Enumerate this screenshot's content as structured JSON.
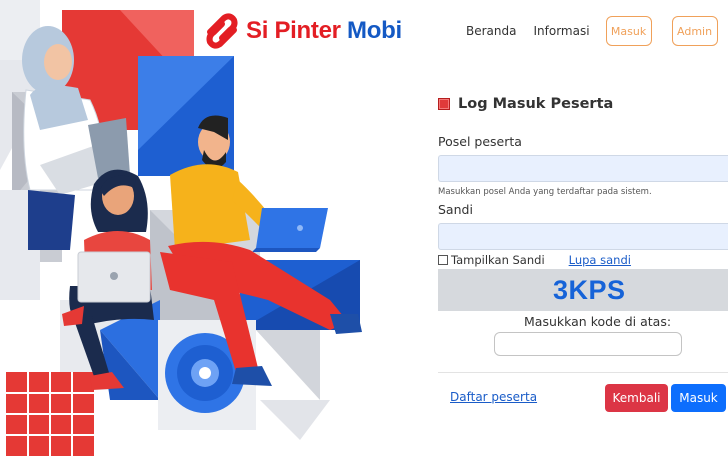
{
  "brand": {
    "name_part1": "Si Pinter ",
    "name_part2": "Mobi",
    "logo_icon": "si-pinter-logo-icon",
    "color_red": "#e31e24",
    "color_blue": "#1459c4"
  },
  "nav": {
    "beranda": "Beranda",
    "informasi": "Informasi",
    "masuk": "Masuk",
    "admin": "Admin",
    "button_outline_color": "#f0a15a"
  },
  "login": {
    "title": "Log Masuk Peserta",
    "title_icon": "red-square-icon",
    "posel_label": "Posel peserta",
    "posel_value": "",
    "posel_help": "Masukkan posel Anda yang terdaftar pada sistem.",
    "sandi_label": "Sandi",
    "sandi_value": "",
    "show_password_label": "Tampilkan Sandi",
    "forgot_password": "Lupa sandi",
    "captcha_text": "3KPS",
    "captcha_prompt": "Masukkan kode di atas:",
    "captcha_value": "",
    "register_link": "Daftar peserta",
    "back_button": "Kembali",
    "submit_button": "Masuk",
    "back_color": "#dc3545",
    "submit_color": "#0d6efd",
    "captcha_color": "#1663d8"
  },
  "illustration": {
    "icon": "people-with-laptops-illustration"
  }
}
